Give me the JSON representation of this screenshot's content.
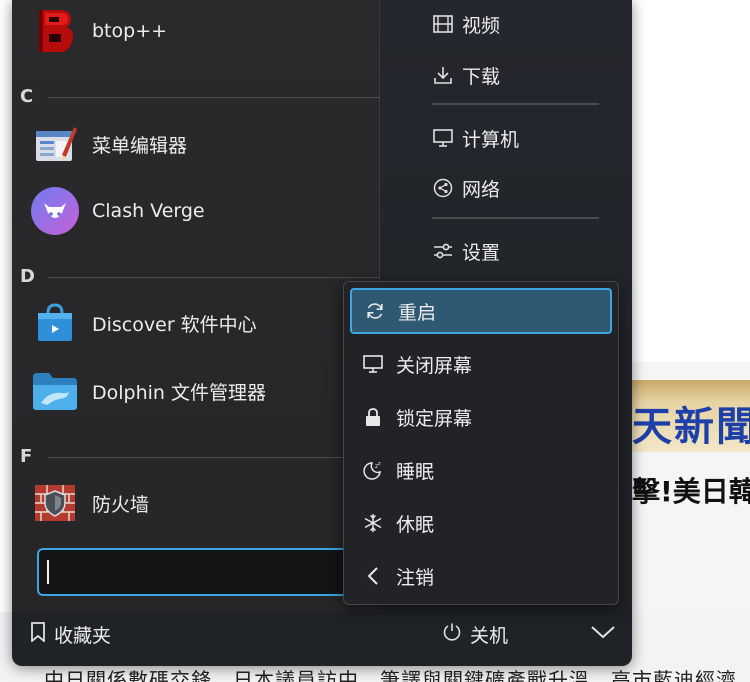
{
  "background": {
    "banner_text": "天新聞網",
    "headline": "擊!美日韓",
    "bottom_text": "中日關係數碼交鋒，日本議員訪中，筆譯與關鍵礦產戰升溫，高市藍迪經濟"
  },
  "sections": [
    {
      "letter": "C"
    },
    {
      "letter": "D"
    },
    {
      "letter": "F"
    }
  ],
  "apps": [
    {
      "label": "btop++",
      "icon": "btop-icon"
    },
    {
      "label": "菜单编辑器",
      "icon": "menu-editor-icon"
    },
    {
      "label": "Clash Verge",
      "icon": "clash-verge-icon"
    },
    {
      "label": "Discover 软件中心",
      "icon": "discover-icon"
    },
    {
      "label": "Dolphin 文件管理器",
      "icon": "dolphin-icon"
    },
    {
      "label": "防火墙",
      "icon": "firewall-icon"
    }
  ],
  "places": [
    {
      "label": "视频",
      "icon": "film-icon"
    },
    {
      "label": "下载",
      "icon": "download-icon"
    },
    {
      "label": "计算机",
      "icon": "monitor-icon"
    },
    {
      "label": "网络",
      "icon": "network-icon"
    },
    {
      "label": "设置",
      "icon": "settings-icon"
    }
  ],
  "power_menu": [
    {
      "label": "重启",
      "icon": "restart-icon",
      "active": true
    },
    {
      "label": "关闭屏幕",
      "icon": "screen-off-icon"
    },
    {
      "label": "锁定屏幕",
      "icon": "lock-icon"
    },
    {
      "label": "睡眠",
      "icon": "sleep-icon"
    },
    {
      "label": "休眠",
      "icon": "hibernate-icon"
    },
    {
      "label": "注销",
      "icon": "logout-icon"
    }
  ],
  "search": {
    "value": ""
  },
  "footer": {
    "favorites_label": "收藏夹",
    "shutdown_label": "关机"
  },
  "colors": {
    "accent": "#3da5e0",
    "panel_bg": "#24272d",
    "active_item_bg": "#2f5873"
  }
}
